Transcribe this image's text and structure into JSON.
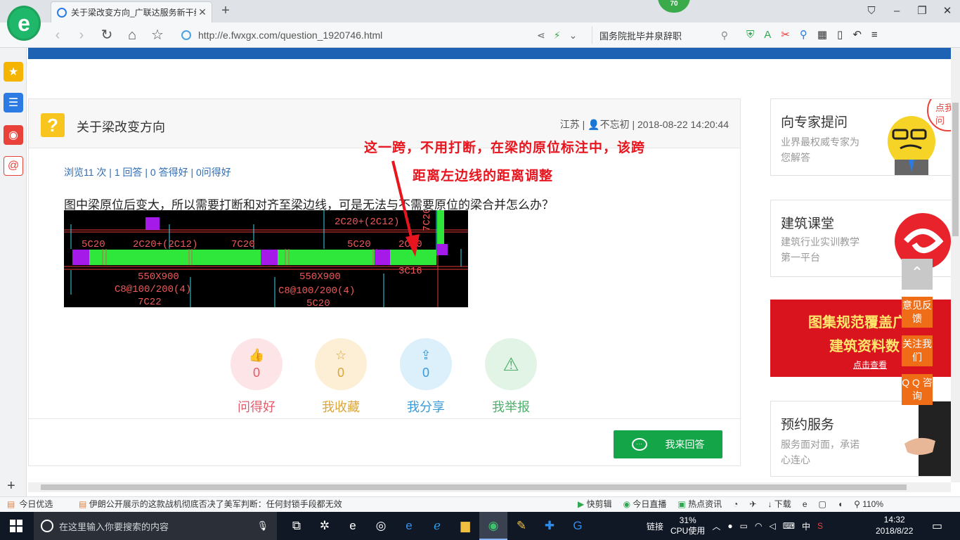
{
  "browser": {
    "tab_title": "关于梁改变方向_广联达服务新干线",
    "new_tab_symbol": "+",
    "counter_badge": "70",
    "url": "http://e.fwxgx.com/question_1920746.html",
    "search_text": "国务院批毕井泉辞职"
  },
  "question": {
    "title": "关于梁改变方向",
    "location": "江苏",
    "author": "不忘初",
    "datetime": "2018-08-22 14:20:44",
    "meta_sep": " | ",
    "stats": "浏览11 次 | 1 回答 | 0 答得好 | 0问得好",
    "body": "图中梁原位后变大，所以需要打断和对齐至梁边线，可是无法与不需要原位的梁合并怎么办？",
    "annotation_line1": "这一跨，不用打断，在梁的原位标注中，该跨",
    "annotation_line2": "距离左边线的距离调整"
  },
  "cad_labels": {
    "a1": "5C20",
    "a2": "2C20+(2C12)",
    "a3": "7C20",
    "a4": "5C20",
    "a5": "2C20",
    "a6": "2C20+(2C12)",
    "a7": "7C20",
    "b1": "550X900",
    "b2": "C8@100/200(4)",
    "b3": "7C22",
    "b4": "550X900",
    "b5": "C8@100/200(4)",
    "b6": "5C20",
    "b7": "3C16"
  },
  "actions": [
    {
      "label": "问得好",
      "count": "0",
      "color": "#e35b6a",
      "bg": "#fde4e7",
      "icon": "thumbs-up-icon",
      "glyph": "👍"
    },
    {
      "label": "我收藏",
      "count": "0",
      "color": "#d9a53c",
      "bg": "#fcefd5",
      "icon": "star-icon",
      "glyph": "☆"
    },
    {
      "label": "我分享",
      "count": "0",
      "color": "#3a9ad9",
      "bg": "#dcf0fb",
      "icon": "share-icon",
      "glyph": "⇪"
    },
    {
      "label": "我举报",
      "count": "",
      "color": "#4fae6a",
      "bg": "#e1f4e6",
      "icon": "warning-icon",
      "glyph": "⚠"
    }
  ],
  "answer_button": "我来回答",
  "sidebar": {
    "expert_title": "向专家提问",
    "expert_desc": "业界最权威专家为您解答",
    "expert_badge": "点我提问",
    "class_title": "建筑课堂",
    "class_desc": "建筑行业实训教学第一平台",
    "banner_line1": "图集规范覆盖广",
    "banner_line2": "建筑资料数",
    "banner_link": "点击查看",
    "booking_title": "预约服务",
    "booking_desc": "服务面对面，承诺心连心"
  },
  "float": {
    "feedback": "意见反馈",
    "follow": "关注我们",
    "qq": "Q Q 咨询"
  },
  "statusbar": {
    "today": "今日优选",
    "news": "伊朗公开展示的这款战机彻底否决了美军判断：任何封锁手段都无效",
    "quick_cut": "快剪辑",
    "live": "今日直播",
    "hot": "热点资讯",
    "download": "下载",
    "zoom": "110%"
  },
  "taskbar": {
    "search_placeholder": "在这里输入你要搜索的内容",
    "link": "链接",
    "cpu_percent": "31%",
    "cpu_label": "CPU使用",
    "ime": "中",
    "time": "14:32",
    "date": "2018/8/22"
  },
  "colors": {
    "accent_blue": "#1d62b3",
    "answer_green": "#13a548",
    "float_orange": "#ef6d16",
    "annotation_red": "#e8141e"
  }
}
